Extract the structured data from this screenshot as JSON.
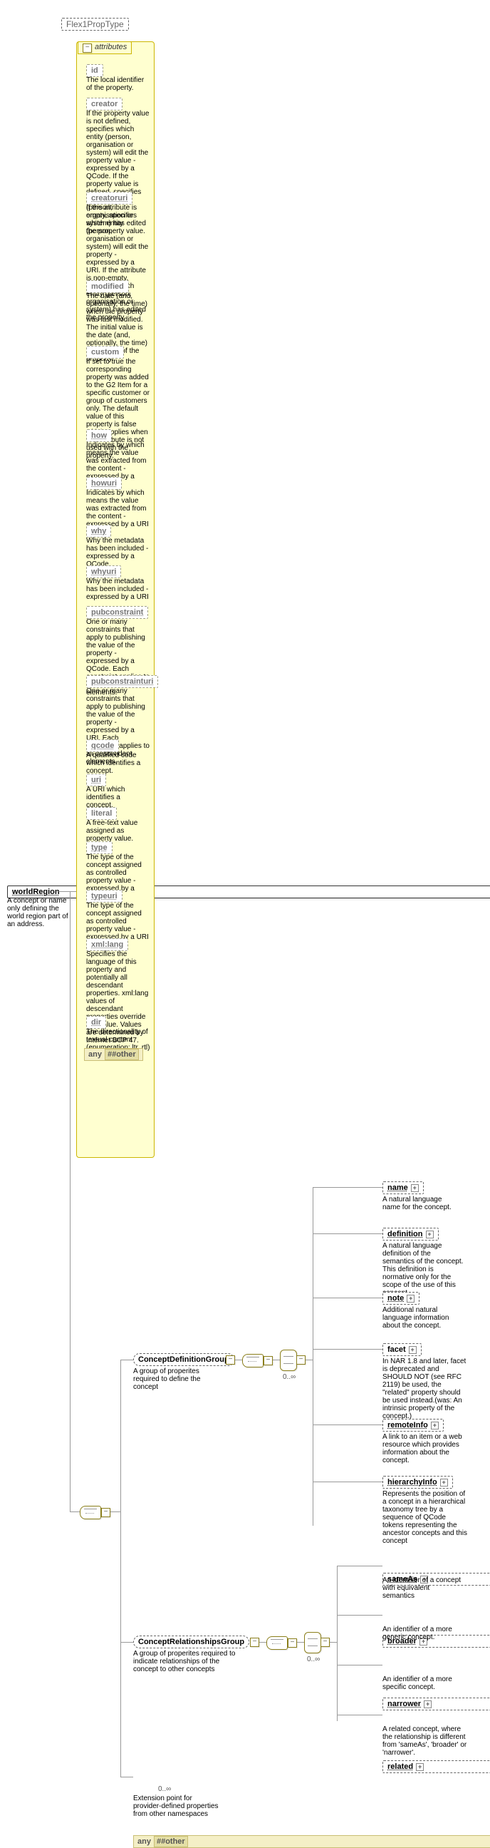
{
  "header": {
    "typeName": "Flex1PropType"
  },
  "root": {
    "name": "worldRegion",
    "desc": "A concept or name only defining the world region part of an address."
  },
  "attrGroup": {
    "label": "attributes",
    "any": {
      "label": "any",
      "other": "##other"
    },
    "items": [
      {
        "name": "id",
        "desc": "The local identifier of the property."
      },
      {
        "name": "creator",
        "desc": "If the property value is not defined, specifies which entity (person, organisation or system) will edit the property value - expressed by a QCode. If the property value is defined, specifies which entity (person, organisation or system) has edited the property value."
      },
      {
        "name": "creatoruri",
        "desc": "If the attribute is empty, specifies which entity (person, organisation or system) will edit the property - expressed by a URI. If the attribute is non-empty, specifies which entity (person, organisation or system) has edited the property."
      },
      {
        "name": "modified",
        "desc": "The date (and, optionally, the time) when the property was last modified. The initial value is the date (and, optionally, the time) of creation of the property."
      },
      {
        "name": "custom",
        "desc": "If set to true the corresponding property was added to the G2 Item for a specific customer or group of customers only. The default value of this property is false which applies when this attribute is not used with the property."
      },
      {
        "name": "how",
        "desc": "Indicates by which means the value was extracted from the content - expressed by a QCode"
      },
      {
        "name": "howuri",
        "desc": "Indicates by which means the value was extracted from the content - expressed by a URI"
      },
      {
        "name": "why",
        "desc": "Why the metadata has been included - expressed by a QCode"
      },
      {
        "name": "whyuri",
        "desc": "Why the metadata has been included - expressed by a URI"
      },
      {
        "name": "pubconstraint",
        "desc": "One or many constraints that apply to publishing the value of the property - expressed by a QCode. Each constraint applies to all descendant elements."
      },
      {
        "name": "pubconstrainturi",
        "desc": "One or many constraints that apply to publishing the value of the property - expressed by a URI. Each constraint applies to all descendant elements."
      },
      {
        "name": "qcode",
        "desc": "A qualified code which identifies a concept."
      },
      {
        "name": "uri",
        "desc": "A URI which identifies a concept."
      },
      {
        "name": "literal",
        "desc": "A free-text value assigned as property value."
      },
      {
        "name": "type",
        "desc": "The type of the concept assigned as controlled property value - expressed by a QCode"
      },
      {
        "name": "typeuri",
        "desc": "The type of the concept assigned as controlled property value - expressed by a URI"
      },
      {
        "name": "xml:lang",
        "desc": "Specifies the language of this property and potentially all descendant properties. xml:lang values of descendant properties override this value. Values are determined by Internet BCP 47."
      },
      {
        "name": "dir",
        "desc": "The directionality of textual content (enumeration: ltr, rtl)"
      }
    ]
  },
  "groups": {
    "conceptDefinition": {
      "name": "ConceptDefinitionGroup",
      "desc": "A group of properites required to define the concept",
      "card": "0..∞",
      "children": [
        {
          "name": "name",
          "desc": "A natural language name for the concept."
        },
        {
          "name": "definition",
          "desc": "A natural language definition of the semantics of the concept. This definition is normative only for the scope of the use of this concept."
        },
        {
          "name": "note",
          "desc": "Additional natural language information about the concept."
        },
        {
          "name": "facet",
          "desc": "In NAR 1.8 and later, facet is deprecated and SHOULD NOT (see RFC 2119) be used, the \"related\" property should be used instead.(was: An intrinsic property of the concept.)"
        },
        {
          "name": "remoteInfo",
          "desc": "A link to an item or a web resource which provides information about the concept."
        },
        {
          "name": "hierarchyInfo",
          "desc": "Represents the position of a concept in a hierarchical taxonomy tree by a sequence of QCode tokens representing the ancestor concepts and this concept"
        }
      ]
    },
    "conceptRelationships": {
      "name": "ConceptRelationshipsGroup",
      "desc": "A group of properites required to indicate relationships of the concept to other concepts",
      "card": "0..∞",
      "children": [
        {
          "name": "sameAs",
          "desc": "An identifier of a concept with equivalent semantics"
        },
        {
          "name": "broader",
          "desc": "An identifier of a more generic concept."
        },
        {
          "name": "narrower",
          "desc": "An identifier of a more specific concept."
        },
        {
          "name": "related",
          "desc": "A related concept, where the relationship is different from 'sameAs', 'broader' or 'narrower'."
        }
      ]
    }
  },
  "anyElement": {
    "label": "any",
    "other": "##other",
    "card": "0..∞",
    "desc": "Extension point for provider-defined properties from other namespaces"
  }
}
